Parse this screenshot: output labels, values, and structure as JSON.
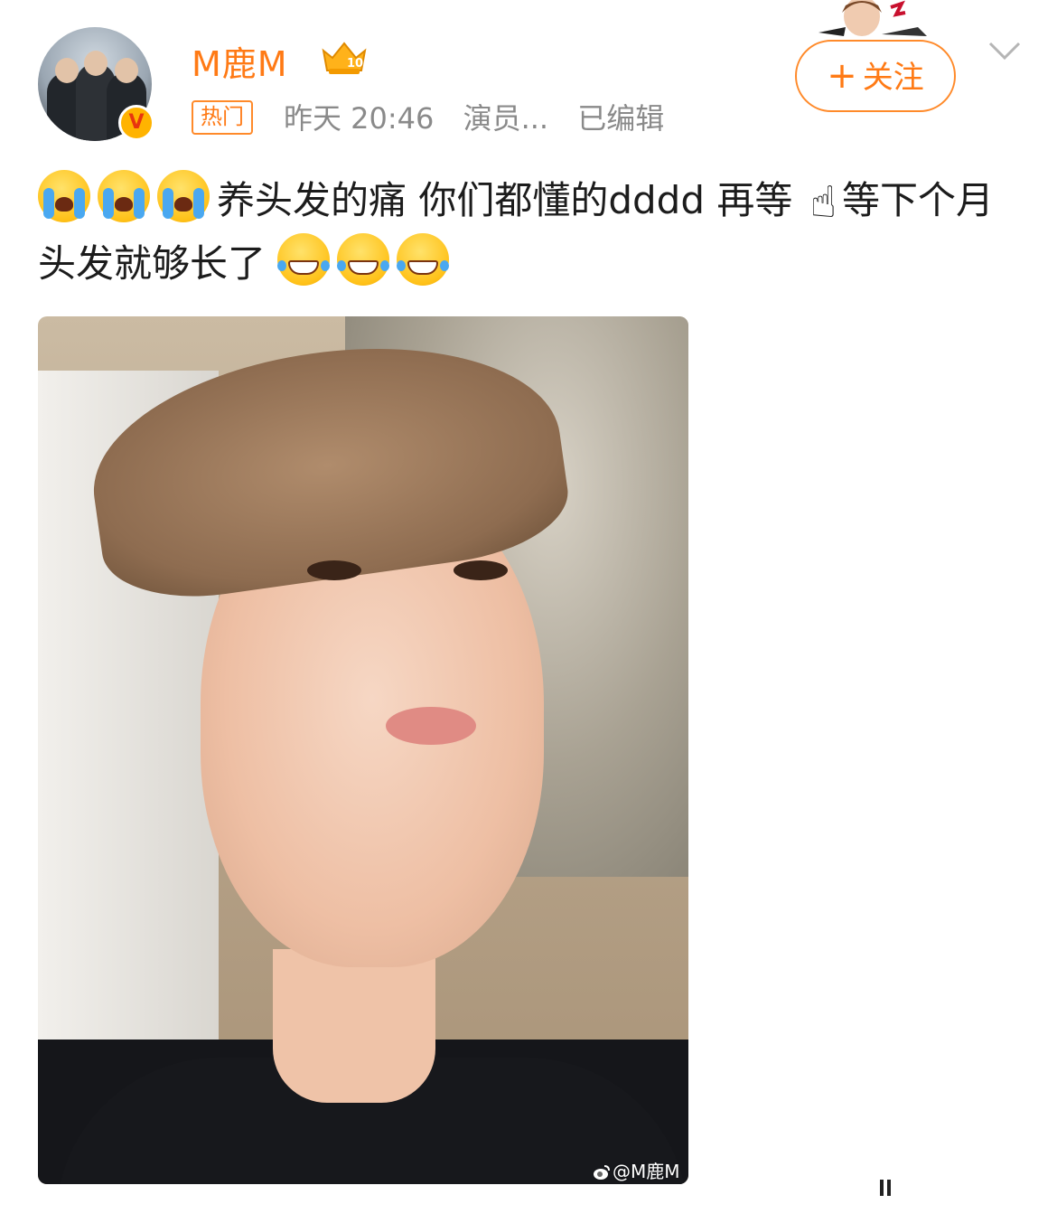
{
  "user": {
    "name": "M鹿M",
    "verified_badge": "V",
    "crown_level": "10"
  },
  "post_meta": {
    "hot_badge": "热门",
    "time": "昨天 20:46",
    "source": "演员...",
    "edited": "已编辑"
  },
  "follow_button": {
    "plus": "+",
    "label": "关注"
  },
  "post": {
    "text_part1": "养头发的痛 你们都懂的dddd 再等",
    "finger_emoji": "☝",
    "text_part2": "等下个月头发就够长了"
  },
  "photo": {
    "watermark": "@M鹿M"
  },
  "colors": {
    "accent": "#ff7a15",
    "meta_gray": "#8a8a8a"
  },
  "icons": [
    "crown-icon",
    "verified-icon",
    "chevron-down-icon",
    "cry-emoji-icon",
    "laugh-emoji-icon",
    "weibo-logo-icon"
  ]
}
